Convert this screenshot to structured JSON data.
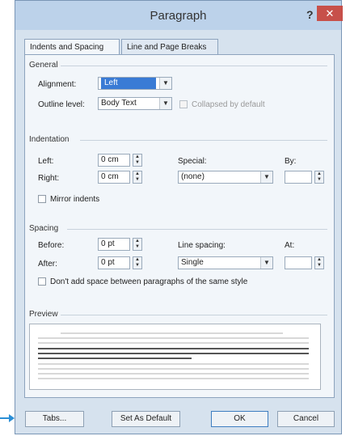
{
  "window": {
    "title": "Paragraph",
    "help": "?",
    "close": "✕"
  },
  "tabs": [
    {
      "label": "Indents and Spacing",
      "active": true
    },
    {
      "label": "Line and Page Breaks",
      "active": false
    }
  ],
  "general": {
    "title": "General",
    "alignment_label": "Alignment:",
    "alignment_value": "Left",
    "outline_label": "Outline level:",
    "outline_value": "Body Text",
    "collapsed_label": "Collapsed by default"
  },
  "indentation": {
    "title": "Indentation",
    "left_label": "Left:",
    "left_value": "0 cm",
    "right_label": "Right:",
    "right_value": "0 cm",
    "special_label": "Special:",
    "special_value": "(none)",
    "by_label": "By:",
    "by_value": "",
    "mirror_label": "Mirror indents"
  },
  "spacing": {
    "title": "Spacing",
    "before_label": "Before:",
    "before_value": "0 pt",
    "after_label": "After:",
    "after_value": "0 pt",
    "line_spacing_label": "Line spacing:",
    "line_spacing_value": "Single",
    "at_label": "At:",
    "at_value": "",
    "dont_add_label": "Don't add space between paragraphs of the same style"
  },
  "preview": {
    "title": "Preview"
  },
  "buttons": {
    "tabs": "Tabs...",
    "set_default": "Set As Default",
    "ok": "OK",
    "cancel": "Cancel"
  },
  "colors": {
    "accent": "#3a7bd5",
    "close": "#c7504a",
    "arrow": "#2b8fd6"
  }
}
